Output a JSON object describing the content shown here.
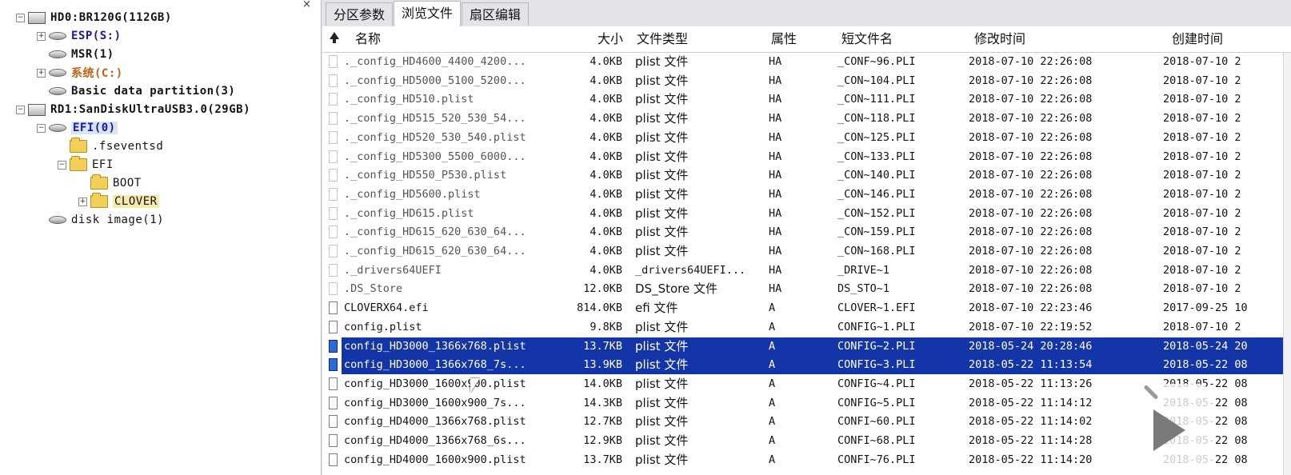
{
  "tree": {
    "close_glyph": "×",
    "nodes": [
      {
        "label": "HD0:BR120G(112GB)",
        "icon": "disk-icon",
        "expander": "-",
        "indent": 0
      },
      {
        "label": "ESP(S:)",
        "icon": "partition-icon",
        "expander": "+",
        "indent": 1,
        "color": "#1a1aa0"
      },
      {
        "label": "MSR(1)",
        "icon": "partition-icon",
        "expander": "",
        "indent": 1,
        "color": "#141414"
      },
      {
        "label": "系统(C:)",
        "icon": "partition-icon",
        "expander": "+",
        "indent": 1,
        "color": "#c06010"
      },
      {
        "label": "Basic data partition(3)",
        "icon": "partition-icon",
        "expander": "",
        "indent": 1,
        "color": "#141414"
      },
      {
        "label": "RD1:SanDiskUltraUSB3.0(29GB)",
        "icon": "disk-icon",
        "expander": "-",
        "indent": 0
      },
      {
        "label": "EFI(0)",
        "icon": "partition-icon",
        "expander": "-",
        "indent": 1,
        "color": "#1a1aa0",
        "selected": true
      },
      {
        "label": ".fseventsd",
        "icon": "folder-icon",
        "expander": "",
        "indent": 2,
        "plain": true
      },
      {
        "label": "EFI",
        "icon": "folder-icon",
        "expander": "-",
        "indent": 2,
        "plain": true
      },
      {
        "label": "BOOT",
        "icon": "folder-icon",
        "expander": "",
        "indent": 3,
        "plain": true
      },
      {
        "label": "CLOVER",
        "icon": "folder-icon",
        "expander": "+",
        "indent": 3,
        "plain": true,
        "highlight": true
      },
      {
        "label": "disk image(1)",
        "icon": "partition-icon",
        "expander": "",
        "indent": 1,
        "plain": true
      }
    ]
  },
  "tabs": [
    {
      "label": "分区参数",
      "active": false
    },
    {
      "label": "浏览文件",
      "active": true
    },
    {
      "label": "扇区编辑",
      "active": false
    }
  ],
  "columns": {
    "up_icon": "up-arrow-icon",
    "name": "名称",
    "size": "大小",
    "type": "文件类型",
    "attr": "属性",
    "short": "短文件名",
    "modified": "修改时间",
    "created": "创建时间"
  },
  "files": [
    {
      "name": "._config_HD4600_4400_4200...",
      "size": "4.0KB",
      "type": "plist 文件",
      "attr": "HA",
      "short": "_CONF~96.PLI",
      "modified": "2018-07-10 22:26:08",
      "created": "2018-07-10 2",
      "faded": true
    },
    {
      "name": "._config_HD5000_5100_5200...",
      "size": "4.0KB",
      "type": "plist 文件",
      "attr": "HA",
      "short": "_CON~104.PLI",
      "modified": "2018-07-10 22:26:08",
      "created": "2018-07-10 2",
      "faded": true
    },
    {
      "name": "._config_HD510.plist",
      "size": "4.0KB",
      "type": "plist 文件",
      "attr": "HA",
      "short": "_CON~111.PLI",
      "modified": "2018-07-10 22:26:08",
      "created": "2018-07-10 2",
      "faded": true
    },
    {
      "name": "._config_HD515_520_530_54...",
      "size": "4.0KB",
      "type": "plist 文件",
      "attr": "HA",
      "short": "_CON~118.PLI",
      "modified": "2018-07-10 22:26:08",
      "created": "2018-07-10 2",
      "faded": true
    },
    {
      "name": "._config_HD520_530_540.plist",
      "size": "4.0KB",
      "type": "plist 文件",
      "attr": "HA",
      "short": "_CON~125.PLI",
      "modified": "2018-07-10 22:26:08",
      "created": "2018-07-10 2",
      "faded": true
    },
    {
      "name": "._config_HD5300_5500_6000...",
      "size": "4.0KB",
      "type": "plist 文件",
      "attr": "HA",
      "short": "_CON~133.PLI",
      "modified": "2018-07-10 22:26:08",
      "created": "2018-07-10 2",
      "faded": true
    },
    {
      "name": "._config_HD550_P530.plist",
      "size": "4.0KB",
      "type": "plist 文件",
      "attr": "HA",
      "short": "_CON~140.PLI",
      "modified": "2018-07-10 22:26:08",
      "created": "2018-07-10 2",
      "faded": true
    },
    {
      "name": "._config_HD5600.plist",
      "size": "4.0KB",
      "type": "plist 文件",
      "attr": "HA",
      "short": "_CON~146.PLI",
      "modified": "2018-07-10 22:26:08",
      "created": "2018-07-10 2",
      "faded": true
    },
    {
      "name": "._config_HD615.plist",
      "size": "4.0KB",
      "type": "plist 文件",
      "attr": "HA",
      "short": "_CON~152.PLI",
      "modified": "2018-07-10 22:26:08",
      "created": "2018-07-10 2",
      "faded": true
    },
    {
      "name": "._config_HD615_620_630_64...",
      "size": "4.0KB",
      "type": "plist 文件",
      "attr": "HA",
      "short": "_CON~159.PLI",
      "modified": "2018-07-10 22:26:08",
      "created": "2018-07-10 2",
      "faded": true
    },
    {
      "name": "._config_HD615_620_630_64...",
      "size": "4.0KB",
      "type": "plist 文件",
      "attr": "HA",
      "short": "_CON~168.PLI",
      "modified": "2018-07-10 22:26:08",
      "created": "2018-07-10 2",
      "faded": true
    },
    {
      "name": "._drivers64UEFI",
      "size": "4.0KB",
      "type": "_drivers64UEFI...",
      "attr": "HA",
      "short": "_DRIVE~1",
      "modified": "2018-07-10 22:26:08",
      "created": "2018-07-10 2",
      "faded": true
    },
    {
      "name": ".DS_Store",
      "size": "12.0KB",
      "type": "DS_Store 文件",
      "attr": "HA",
      "short": "DS_STO~1",
      "modified": "2018-07-10 22:26:08",
      "created": "2018-07-10 2",
      "faded": true
    },
    {
      "name": "CLOVERX64.efi",
      "size": "814.0KB",
      "type": "efi 文件",
      "attr": "A",
      "short": "CLOVER~1.EFI",
      "modified": "2018-07-10 22:23:46",
      "created": "2017-09-25 10",
      "faded": false
    },
    {
      "name": "config.plist",
      "size": "9.8KB",
      "type": "plist 文件",
      "attr": "A",
      "short": "CONFIG~1.PLI",
      "modified": "2018-07-10 22:19:52",
      "created": "2018-07-10 2",
      "faded": false
    },
    {
      "name": "config_HD3000_1366x768.plist",
      "size": "13.7KB",
      "type": "plist 文件",
      "attr": "A",
      "short": "CONFIG~2.PLI",
      "modified": "2018-05-24 20:28:46",
      "created": "2018-05-24 20",
      "faded": false,
      "selected": true
    },
    {
      "name": "config_HD3000_1366x768_7s...",
      "size": "13.9KB",
      "type": "plist 文件",
      "attr": "A",
      "short": "CONFIG~3.PLI",
      "modified": "2018-05-22 11:13:54",
      "created": "2018-05-22 08",
      "faded": false,
      "selected": true
    },
    {
      "name": "config_HD3000_1600x900.plist",
      "size": "14.0KB",
      "type": "plist 文件",
      "attr": "A",
      "short": "CONFIG~4.PLI",
      "modified": "2018-05-22 11:13:26",
      "created": "2018-05-22 08",
      "faded": false
    },
    {
      "name": "config_HD3000_1600x900_7s...",
      "size": "14.3KB",
      "type": "plist 文件",
      "attr": "A",
      "short": "CONFIG~5.PLI",
      "modified": "2018-05-22 11:14:12",
      "created": "2018-05-22 08",
      "faded": false
    },
    {
      "name": "config_HD4000_1366x768.plist",
      "size": "12.7KB",
      "type": "plist 文件",
      "attr": "A",
      "short": "CONFI~60.PLI",
      "modified": "2018-05-22 11:14:02",
      "created": "2018-05-22 08",
      "faded": false
    },
    {
      "name": "config_HD4000_1366x768_6s...",
      "size": "12.9KB",
      "type": "plist 文件",
      "attr": "A",
      "short": "CONFI~68.PLI",
      "modified": "2018-05-22 11:14:28",
      "created": "2018-05-22 08",
      "faded": false
    },
    {
      "name": "config_HD4000_1600x900.plist",
      "size": "13.7KB",
      "type": "plist 文件",
      "attr": "A",
      "short": "CONFI~76.PLI",
      "modified": "2018-05-22 11:14:20",
      "created": "2018-05-22 08",
      "faded": false
    }
  ],
  "overlay": {
    "play_icon": "play-icon",
    "cursor_icon": "mouse-cursor-icon"
  }
}
